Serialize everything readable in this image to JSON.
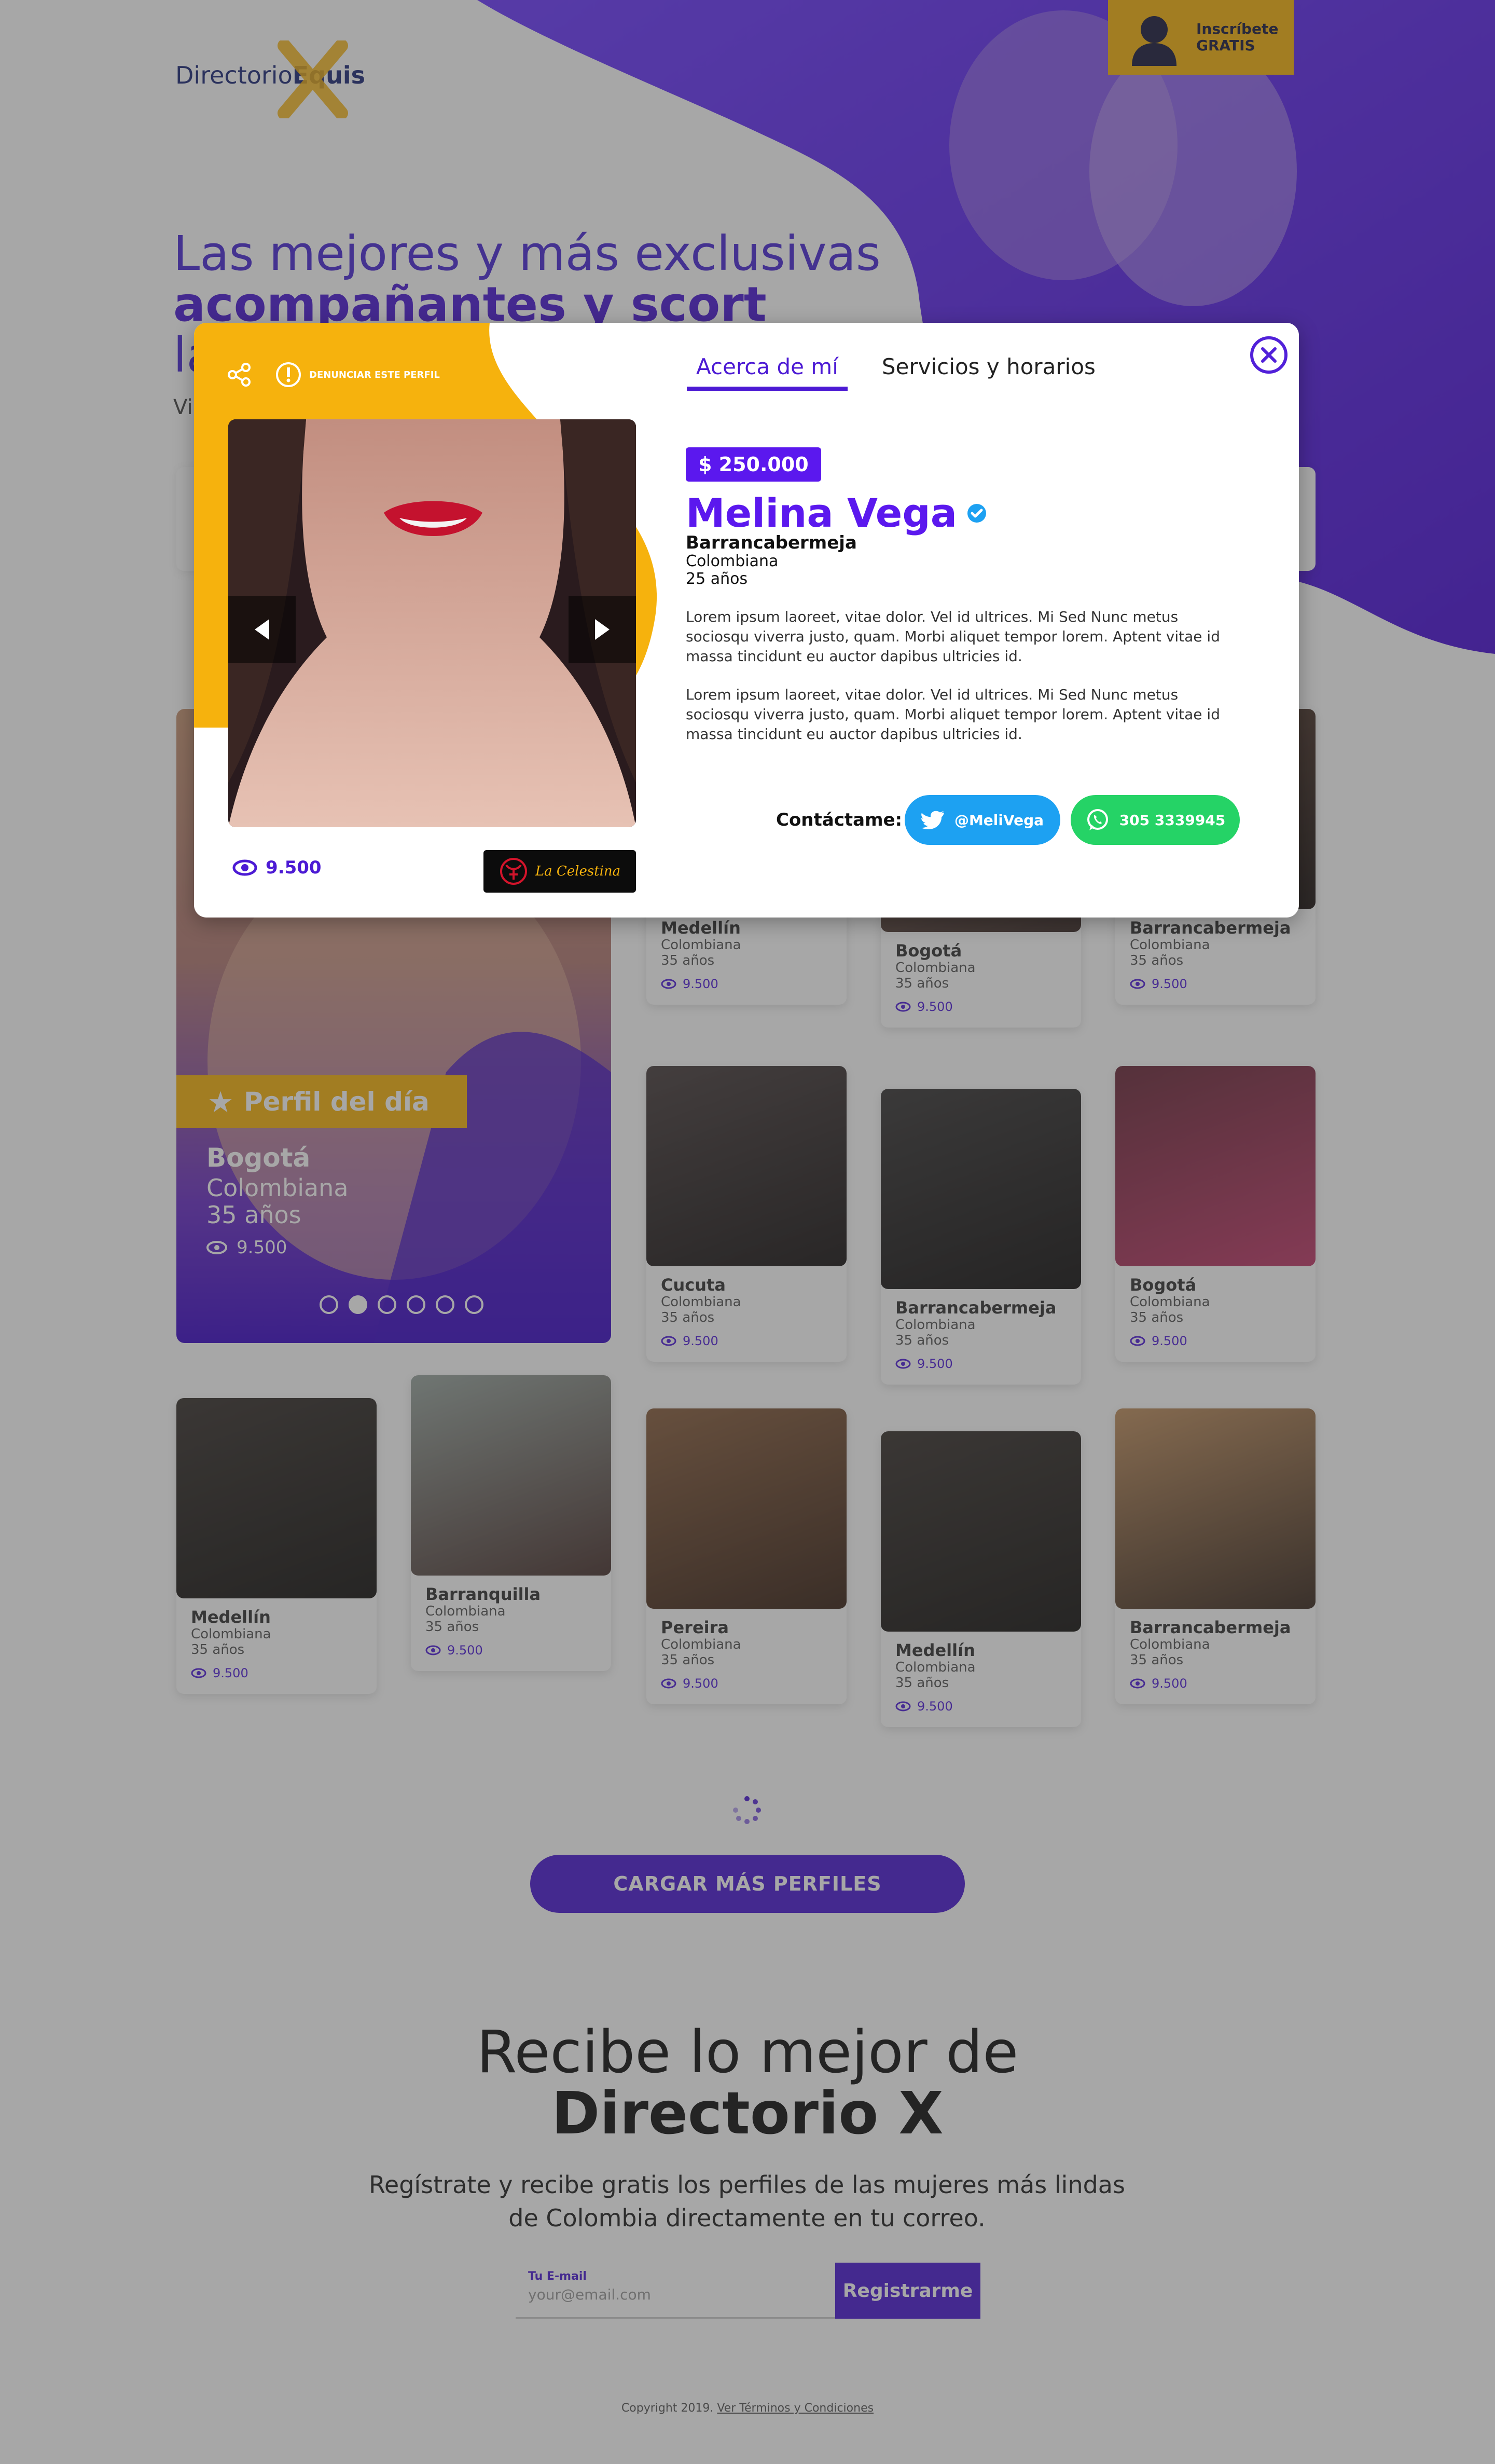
{
  "header": {
    "logo_part1": "Directorio",
    "logo_part2": "Equis",
    "signup_line1": "Inscríbete",
    "signup_line2": "GRATIS"
  },
  "hero": {
    "title_line1": "Las mejores y más exclusivas",
    "title_line2": "acompañantes y scort",
    "title_line3": "la",
    "subtitle": "Vi"
  },
  "featured": {
    "ribbon": "Perfil del día",
    "city": "Bogotá",
    "nationality": "Colombiana",
    "age": "35 años",
    "views": "9.500",
    "slides": 6,
    "active_slide": 2
  },
  "cards": [
    {
      "city": "Medellín",
      "nationality": "Colombiana",
      "age": "35 años",
      "views": "9.500"
    },
    {
      "city": "Bogotá",
      "nationality": "Colombiana",
      "age": "35 años",
      "views": "9.500"
    },
    {
      "city": "Barrancabermeja",
      "nationality": "Colombiana",
      "age": "35 años",
      "views": "9.500"
    },
    {
      "city": "Cucuta",
      "nationality": "Colombiana",
      "age": "35 años",
      "views": "9.500"
    },
    {
      "city": "Barrancabermeja",
      "nationality": "Colombiana",
      "age": "35 años",
      "views": "9.500"
    },
    {
      "city": "Bogotá",
      "nationality": "Colombiana",
      "age": "35 años",
      "views": "9.500"
    },
    {
      "city": "Medellín",
      "nationality": "Colombiana",
      "age": "35 años",
      "views": "9.500"
    },
    {
      "city": "Barranquilla",
      "nationality": "Colombiana",
      "age": "35 años",
      "views": "9.500"
    },
    {
      "city": "Pereira",
      "nationality": "Colombiana",
      "age": "35 años",
      "views": "9.500"
    },
    {
      "city": "Medellín",
      "nationality": "Colombiana",
      "age": "35 años",
      "views": "9.500"
    },
    {
      "city": "Barrancabermeja",
      "nationality": "Colombiana",
      "age": "35 años",
      "views": "9.500"
    }
  ],
  "load_more_label": "CARGAR MÁS PERFILES",
  "newsletter": {
    "title_line1": "Recibe lo mejor de",
    "title_line2": "Directorio X",
    "description": "Regístrate y recibe gratis los perfiles de las mujeres más lindas de Colombia directamente en tu correo.",
    "email_label": "Tu E-mail",
    "email_placeholder": "your@email.com",
    "submit_label": "Registrarme"
  },
  "footer": {
    "copyright": "Copyright 2019.",
    "terms_link": "Ver Términos y Condiciones"
  },
  "modal": {
    "report_label": "DENUNCIAR ESTE PERFIL",
    "tabs": [
      "Acerca de mí",
      "Servicios y horarios"
    ],
    "active_tab": 0,
    "price": "$ 250.000",
    "name": "Melina Vega",
    "city": "Barrancabermeja",
    "nationality": "Colombiana",
    "age": "25 años",
    "bio_paragraphs": [
      "Lorem ipsum laoreet, vitae dolor. Vel id ultrices. Mi Sed Nunc metus sociosqu viverra justo, quam. Morbi aliquet tempor lorem. Aptent vitae id massa tincidunt eu auctor dapibus ultricies id.",
      "Lorem ipsum laoreet, vitae dolor. Vel id ultrices. Mi Sed Nunc metus sociosqu viverra justo, quam. Morbi aliquet tempor lorem. Aptent vitae id massa tincidunt eu auctor dapibus ultricies id."
    ],
    "views": "9.500",
    "sponsor": "La Celestina",
    "contact_label": "Contáctame:",
    "twitter_handle": "@MeliVega",
    "whatsapp_number": "305 3339945"
  },
  "colors": {
    "primary": "#4c1ad4",
    "accent": "#f6b20d",
    "twitter": "#1da1f2",
    "whatsapp": "#25d366"
  },
  "icons": [
    "share-icon",
    "alert-icon",
    "chevron-left-icon",
    "chevron-right-icon",
    "eye-icon",
    "verified-icon",
    "close-icon",
    "twitter-icon",
    "whatsapp-icon",
    "star-icon",
    "user-icon"
  ]
}
